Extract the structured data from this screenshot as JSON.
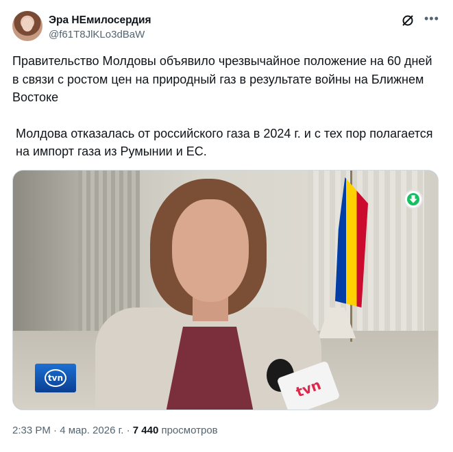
{
  "author": {
    "name": "Эра НЕмилосердия",
    "handle": "@f61T8JlKLo3dBaW"
  },
  "icons": {
    "grok": "grok-icon",
    "more": "more-icon",
    "download": "download-arrow-icon"
  },
  "tweet": {
    "paragraph1": "Правительство Молдовы объявило чрезвычайное положение на 60 дней в связи с ростом цен на природный газ в результате войны на Ближнем Востоке",
    "paragraph2": "Молдова отказалась от российского газа в 2024 г. и с тех пор полагается на импорт газа из Румынии и ЕС."
  },
  "media": {
    "channel_logo": "tvn",
    "mic_logo": "tvn"
  },
  "meta": {
    "time": "2:33 PM",
    "separator": "·",
    "date": "4 мар. 2026 г.",
    "views_count": "7 440",
    "views_label": "просмотров"
  },
  "colors": {
    "text_primary": "#0f1419",
    "text_secondary": "#536471",
    "download_green": "#17bf63"
  }
}
